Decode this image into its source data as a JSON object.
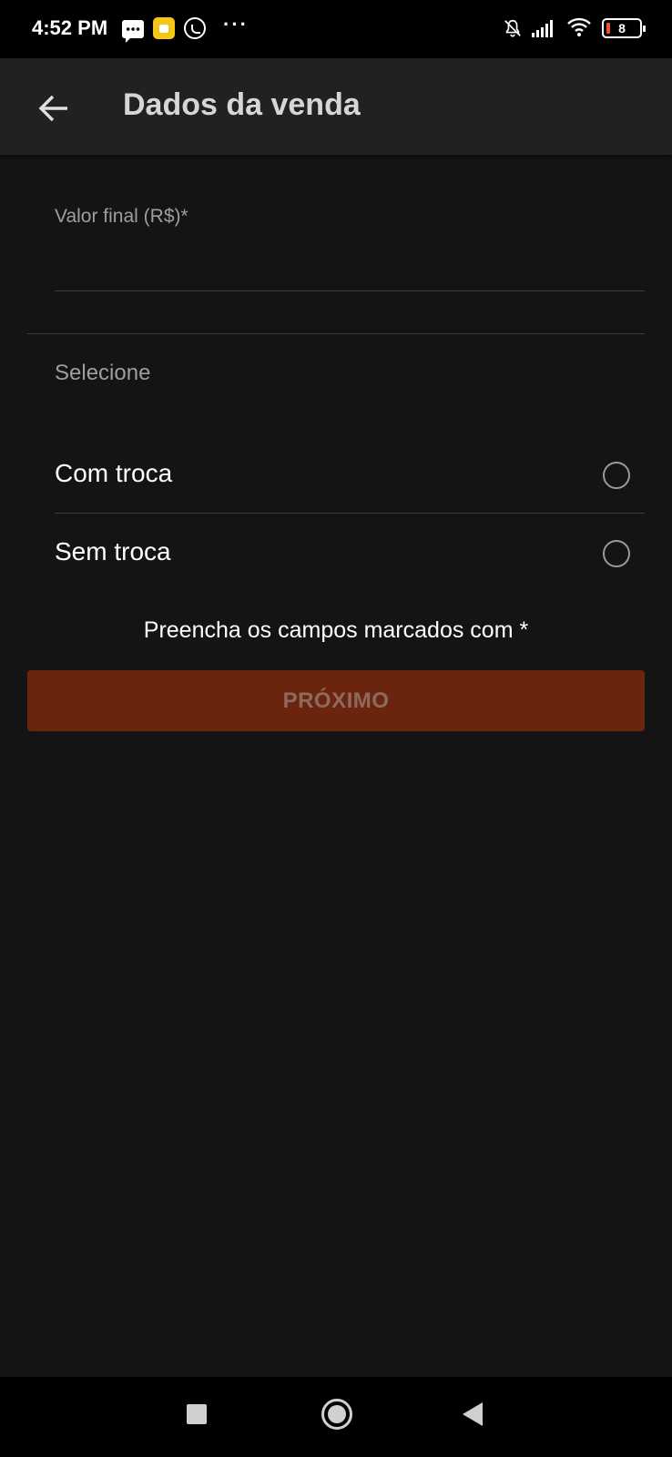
{
  "status_bar": {
    "time": "4:52 PM",
    "more": "···",
    "battery_level": "8",
    "icons": [
      "message-icon",
      "shopping-icon",
      "whatsapp-icon",
      "bell-off-icon",
      "signal-icon",
      "wifi-icon",
      "battery-icon"
    ]
  },
  "app_bar": {
    "title": "Dados da venda",
    "back_icon": "arrow-back-icon"
  },
  "form": {
    "value_label": "Valor final (R$)*",
    "value_input": "",
    "section_label": "Selecione",
    "options": [
      {
        "label": "Com troca",
        "selected": false
      },
      {
        "label": "Sem troca",
        "selected": false
      }
    ],
    "hint": "Preencha os campos marcados com *",
    "next_label": "PRÓXIMO"
  },
  "colors": {
    "background": "#141414",
    "app_bar": "#212121",
    "button_bg": "#6b250e",
    "button_text": "#8e6a5e",
    "secondary_text": "#9e9e9e"
  },
  "nav_bar": {
    "icons": [
      "recents-icon",
      "home-icon",
      "back-icon"
    ]
  }
}
